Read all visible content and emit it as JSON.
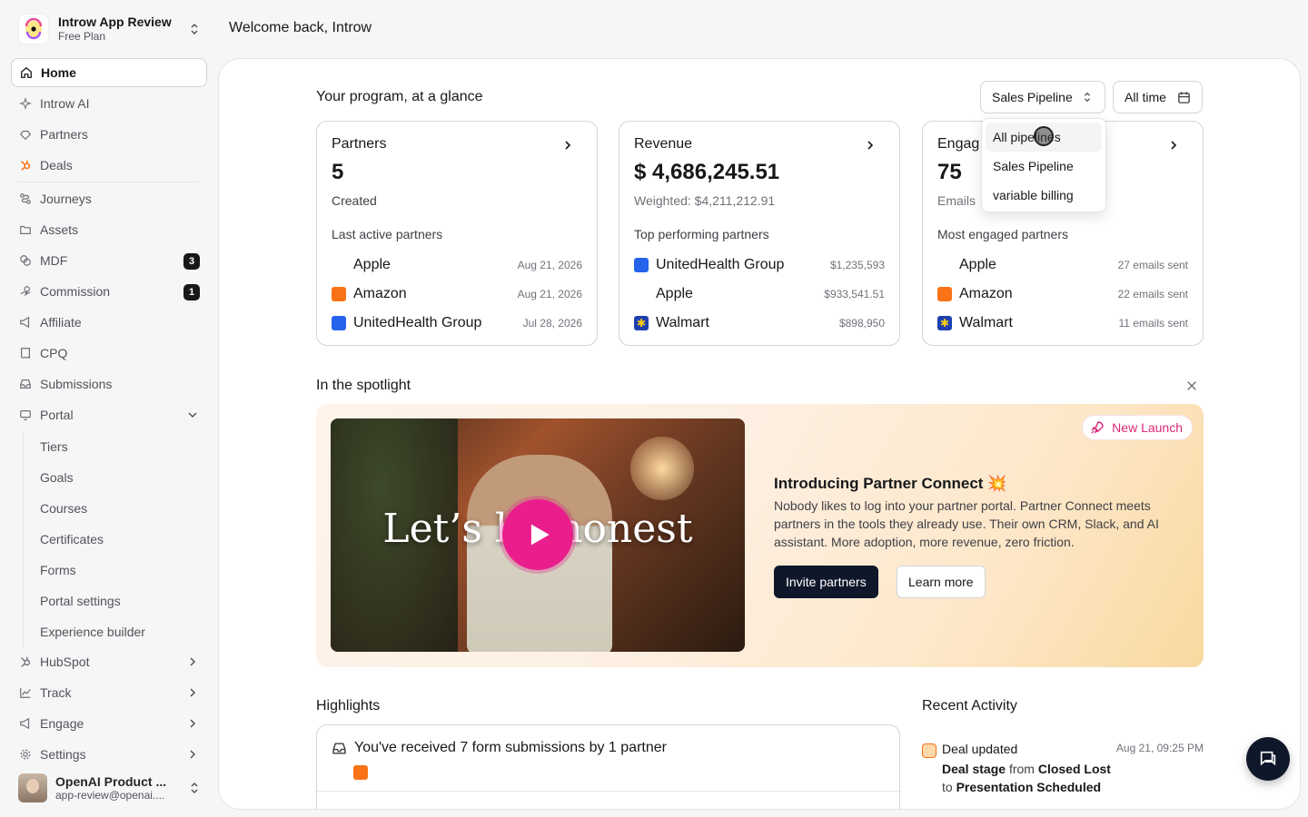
{
  "org": {
    "name": "Introw App Review",
    "plan": "Free Plan"
  },
  "welcome": "Welcome back, Introw",
  "nav": {
    "home": "Home",
    "ai": "Introw AI",
    "partners": "Partners",
    "deals": "Deals",
    "journeys": "Journeys",
    "assets": "Assets",
    "mdf": "MDF",
    "mdf_badge": "3",
    "commission": "Commission",
    "commission_badge": "1",
    "affiliate": "Affiliate",
    "cpq": "CPQ",
    "submissions": "Submissions",
    "portal": "Portal",
    "portal_sub": [
      "Tiers",
      "Goals",
      "Courses",
      "Certificates",
      "Forms",
      "Portal settings",
      "Experience builder"
    ],
    "hubspot": "HubSpot",
    "track": "Track",
    "engage": "Engage",
    "settings": "Settings"
  },
  "user": {
    "name": "OpenAI Product ...",
    "email": "app-review@openai...."
  },
  "glance": {
    "title": "Your program, at a glance",
    "pipeline_selected": "Sales Pipeline",
    "time_range": "All time",
    "pipeline_options": [
      "All pipelines",
      "Sales Pipeline",
      "variable billing"
    ]
  },
  "cards": {
    "partners": {
      "title": "Partners",
      "value": "5",
      "sub": "Created",
      "list_heading": "Last active partners",
      "rows": [
        {
          "name": "Apple",
          "meta": "Aug 21, 2026"
        },
        {
          "name": "Amazon",
          "meta": "Aug 21, 2026"
        },
        {
          "name": "UnitedHealth Group",
          "meta": "Jul 28, 2026"
        }
      ]
    },
    "revenue": {
      "title": "Revenue",
      "value": "$ 4,686,245.51",
      "sub": "Weighted: $4,211,212.91",
      "list_heading": "Top performing partners",
      "rows": [
        {
          "name": "UnitedHealth Group",
          "meta": "$1,235,593"
        },
        {
          "name": "Apple",
          "meta": "$933,541.51"
        },
        {
          "name": "Walmart",
          "meta": "$898,950"
        }
      ]
    },
    "engagement": {
      "title": "Engag",
      "value": "75",
      "sub": "Emails",
      "list_heading": "Most engaged partners",
      "rows": [
        {
          "name": "Apple",
          "meta": "27 emails sent"
        },
        {
          "name": "Amazon",
          "meta": "22 emails sent"
        },
        {
          "name": "Walmart",
          "meta": "11 emails sent"
        }
      ]
    }
  },
  "spotlight": {
    "title": "In the spotlight",
    "badge": "New Launch",
    "video_caption": "Let’s be honest",
    "heading": "Introducing Partner Connect 💥",
    "description": "Nobody likes to log into your partner portal. Partner Connect meets partners in the tools they already use. Their own CRM, Slack, and AI assistant. More adoption, more revenue, zero friction.",
    "primary_cta": "Invite partners",
    "secondary_cta": "Learn more"
  },
  "highlights": {
    "title": "Highlights",
    "item": "You've received 7 form submissions by 1 partner"
  },
  "activity": {
    "title": "Recent Activity",
    "label": "Deal updated",
    "time": "Aug 21, 09:25 PM",
    "field": "Deal stage",
    "from_word": "from",
    "from_value": "Closed Lost",
    "to_word": "to",
    "to_value": "Presentation Scheduled"
  }
}
